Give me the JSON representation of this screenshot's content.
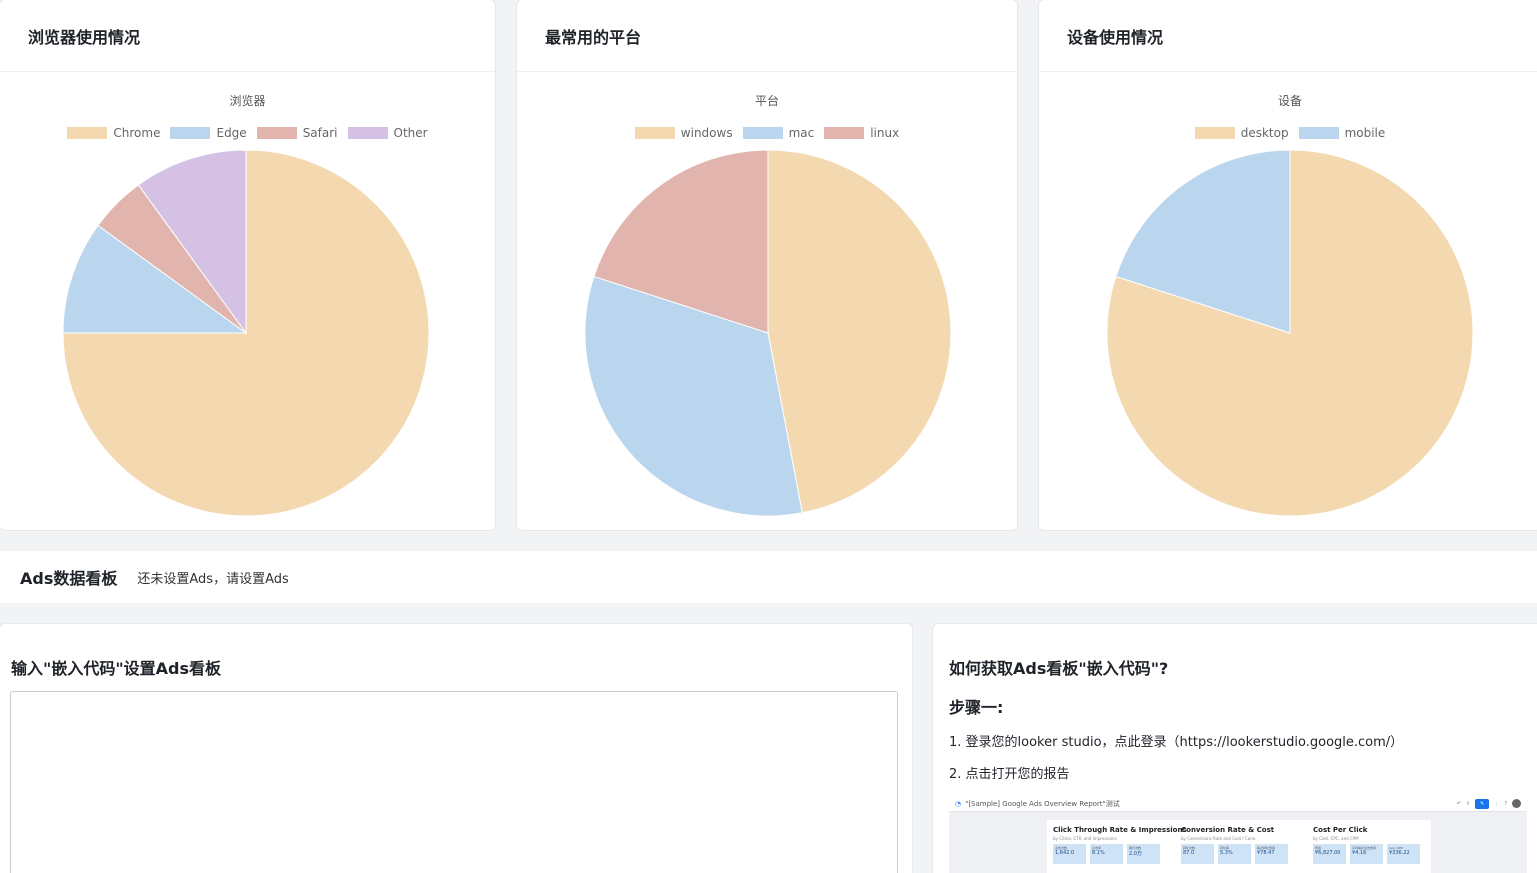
{
  "charts": [
    {
      "card_title": "浏览器使用情况",
      "chart_data": {
        "type": "pie",
        "title": "浏览器",
        "categories": [
          "Chrome",
          "Edge",
          "Safari",
          "Other"
        ],
        "values": [
          75,
          10,
          5,
          10
        ],
        "colors": [
          "#f4d8b0",
          "#b9d6ee",
          "#e2b4ae",
          "#d4c1e4"
        ]
      }
    },
    {
      "card_title": "最常用的平台",
      "chart_data": {
        "type": "pie",
        "title": "平台",
        "categories": [
          "windows",
          "mac",
          "linux"
        ],
        "values": [
          47,
          33,
          20
        ],
        "colors": [
          "#f4d8b0",
          "#b9d6ee",
          "#e2b4ae"
        ]
      }
    },
    {
      "card_title": "设备使用情况",
      "chart_data": {
        "type": "pie",
        "title": "设备",
        "categories": [
          "desktop",
          "mobile"
        ],
        "values": [
          80,
          20
        ],
        "colors": [
          "#f4d8b0",
          "#b9d6ee"
        ]
      }
    }
  ],
  "ads": {
    "title": "Ads数据看板",
    "note": "还未设置Ads，请设置Ads"
  },
  "embed": {
    "title": "输入\"嵌入代码\"设置Ads看板",
    "value": ""
  },
  "howto": {
    "title": "如何获取Ads看板\"嵌入代码\"?",
    "step_title": "步骤一:",
    "step1": "1. 登录您的looker studio，点此登录（https://lookerstudio.google.com/）",
    "step2": "2. 点击打开您的报告",
    "screenshot": {
      "report_name": "\"[Sample] Google Ads Overview Report\"测试",
      "sections": [
        {
          "heading": "Click Through Rate & Impressions",
          "sub": "by Clicks, CTR, and Impressions",
          "tiles": [
            {
              "label": "点击次数",
              "value": "1,642.0"
            },
            {
              "label": "点击率",
              "value": "8.1%"
            },
            {
              "label": "展示次数",
              "value": "2.0万"
            }
          ]
        },
        {
          "heading": "Conversion Rate & Cost",
          "sub": "by Conversions Rate and Cost / Conv.",
          "tiles": [
            {
              "label": "转化次数",
              "value": "87.0"
            },
            {
              "label": "转化率",
              "value": "5.3%"
            },
            {
              "label": "每次转化费用",
              "value": "¥78.47"
            }
          ]
        },
        {
          "heading": "Cost Per Click",
          "sub": "by Cost, CPC, and CPM",
          "tiles": [
            {
              "label": "费用",
              "value": "¥6,827.00"
            },
            {
              "label": "平均每次点击费用",
              "value": "¥4.16"
            },
            {
              "label": "Avg. CPM",
              "value": "¥336.22"
            }
          ]
        }
      ]
    }
  }
}
